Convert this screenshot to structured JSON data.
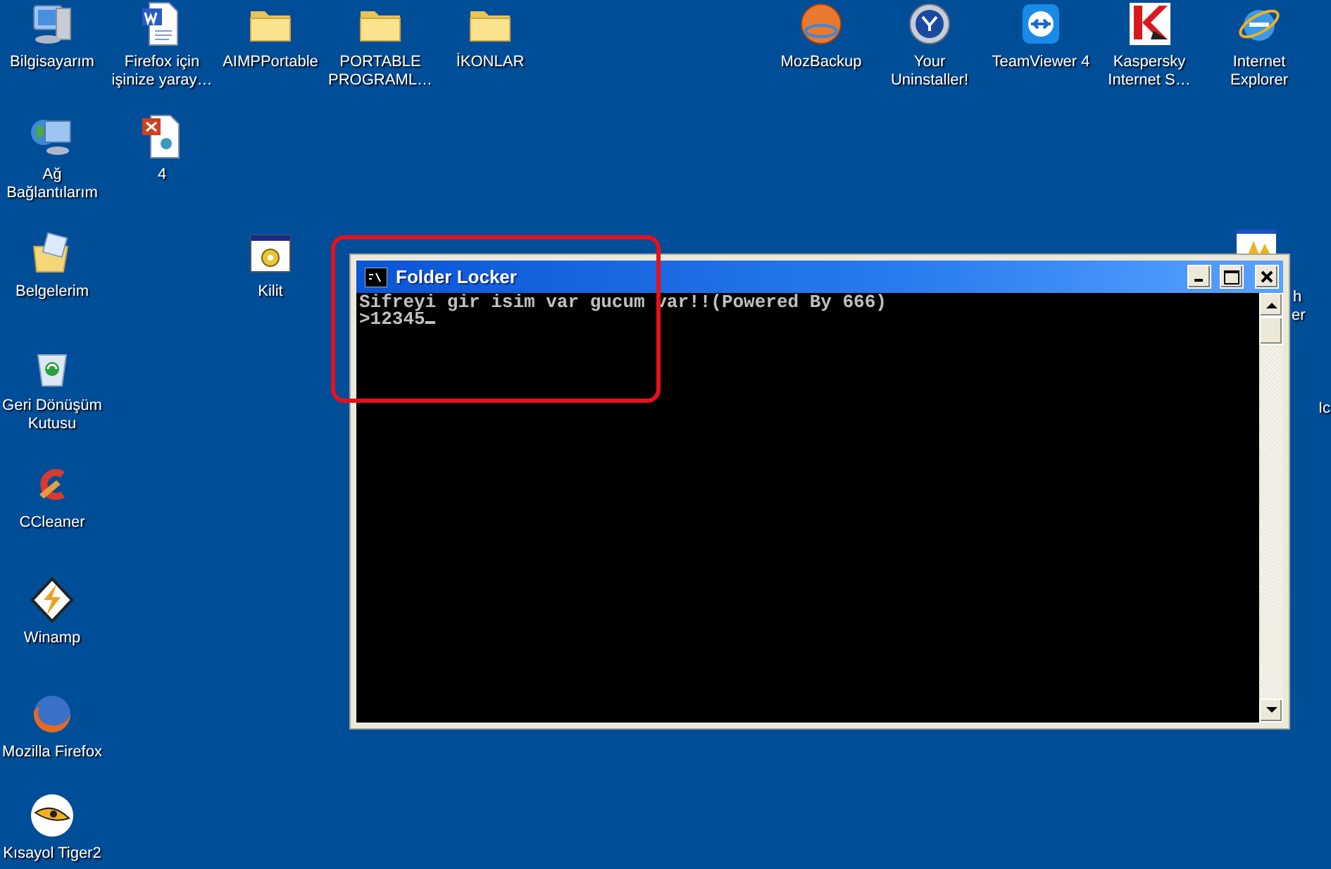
{
  "desktop_icons": [
    {
      "kind": "computer",
      "label": "Bilgisayarım"
    },
    {
      "kind": "word-doc",
      "label": "Firefox için işinize yaray…"
    },
    {
      "kind": "folder",
      "label": "AIMPPortable"
    },
    {
      "kind": "folder",
      "label": "PORTABLE PROGRAML…"
    },
    {
      "kind": "folder",
      "label": "İKONLAR"
    },
    {
      "kind": "network",
      "label": "Ağ Bağlantılarım"
    },
    {
      "kind": "slide-doc",
      "label": "4"
    },
    {
      "kind": "documents",
      "label": "Belgelerim"
    },
    {
      "kind": "app-window",
      "label": "Kilit"
    },
    {
      "kind": "recycle-bin",
      "label": "Geri Dönüşüm Kutusu"
    },
    {
      "kind": "ccleaner",
      "label": "CCleaner"
    },
    {
      "kind": "winamp",
      "label": "Winamp"
    },
    {
      "kind": "firefox",
      "label": "Mozilla Firefox"
    },
    {
      "kind": "eye",
      "label": "Kısayol Tiger2"
    },
    {
      "kind": "orange-globe",
      "label": "MozBackup"
    },
    {
      "kind": "uninstaller",
      "label": "Your Uninstaller!"
    },
    {
      "kind": "teamviewer",
      "label": "TeamViewer 4"
    },
    {
      "kind": "kaspersky",
      "label": "Kaspersky Internet S…"
    },
    {
      "kind": "ie",
      "label": "Internet Explorer"
    }
  ],
  "partial_labels": [
    "h",
    "er",
    "Ic"
  ],
  "console_window": {
    "title": "Folder Locker",
    "lines": [
      "Sifreyi gir isim var gucum var!!(Powered By 666)",
      ">12345"
    ],
    "cursor": true
  }
}
